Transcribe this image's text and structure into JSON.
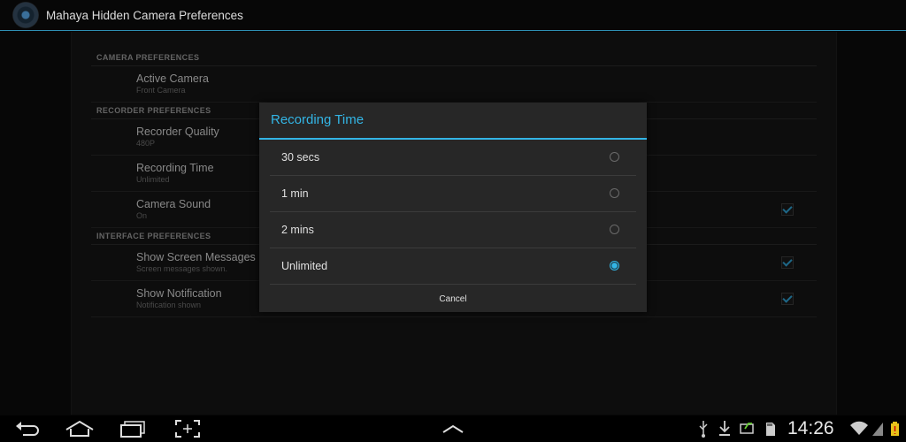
{
  "app": {
    "title": "Mahaya Hidden Camera Preferences",
    "icon": "camera-lens-icon"
  },
  "prefs": {
    "camera_category": "CAMERA PREFERENCES",
    "active_camera": {
      "title": "Active Camera",
      "summary": "Front Camera"
    },
    "recorder_category": "RECORDER PREFERENCES",
    "recorder_quality": {
      "title": "Recorder Quality",
      "summary": "480P"
    },
    "recording_time": {
      "title": "Recording Time",
      "summary": "Unlimited"
    },
    "camera_sound": {
      "title": "Camera Sound",
      "summary": "On",
      "checked": true
    },
    "interface_category": "INTERFACE PREFERENCES",
    "show_screen_messages": {
      "title": "Show Screen Messages",
      "summary": "Screen messages shown.",
      "checked": true
    },
    "show_notification": {
      "title": "Show Notification",
      "summary": "Notification shown",
      "checked": true
    }
  },
  "dialog": {
    "title": "Recording Time",
    "options": [
      "30 secs",
      "1 min",
      "2 mins",
      "Unlimited"
    ],
    "selected": "Unlimited",
    "cancel_label": "Cancel"
  },
  "status": {
    "time": "14:26"
  },
  "colors": {
    "accent": "#33b5e5",
    "background": "#0b0b0b"
  }
}
